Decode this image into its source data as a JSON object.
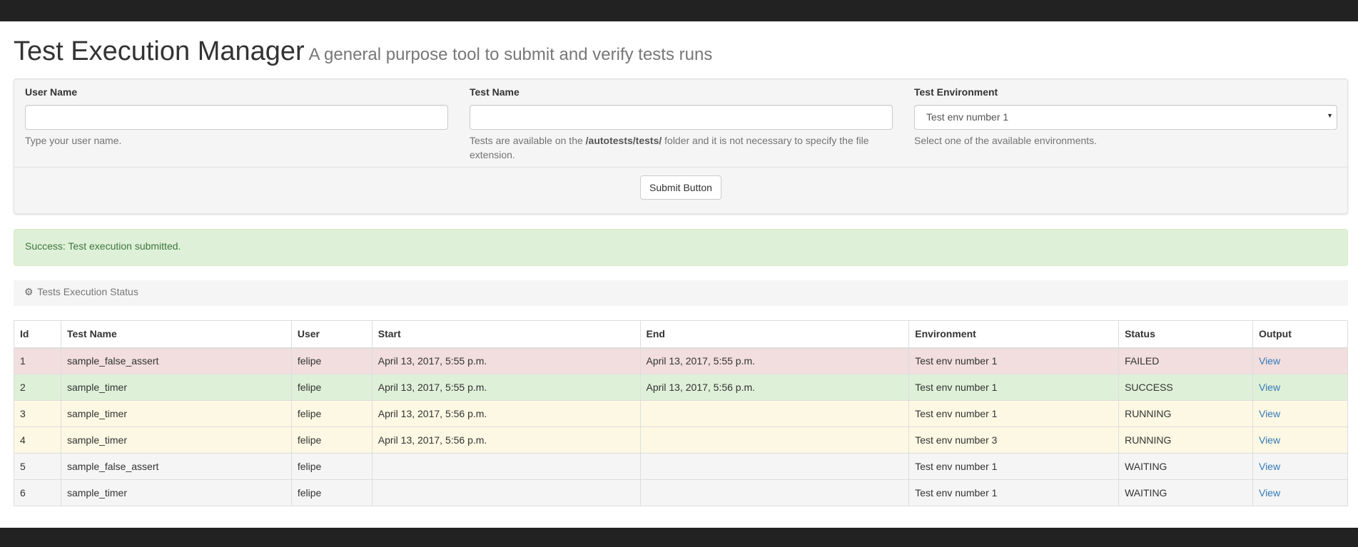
{
  "header": {
    "title": "Test Execution Manager",
    "subtitle": "A general purpose tool to submit and verify tests runs"
  },
  "form": {
    "user_name": {
      "label": "User Name",
      "value": "",
      "help": "Type your user name."
    },
    "test_name": {
      "label": "Test Name",
      "value": "",
      "help_before": "Tests are available on the ",
      "help_path": "/autotests/tests/",
      "help_after": " folder and it is not necessary to specify the file extension."
    },
    "test_environment": {
      "label": "Test Environment",
      "selected": "Test env number 1",
      "help": "Select one of the available environments."
    },
    "submit_label": "Submit Button"
  },
  "alert": {
    "text": "Success: Test execution submitted."
  },
  "status_panel": {
    "icon": "dashboard-icon",
    "title": "Tests Execution Status"
  },
  "table": {
    "columns": [
      "Id",
      "Test Name",
      "User",
      "Start",
      "End",
      "Environment",
      "Status",
      "Output"
    ],
    "rows": [
      {
        "id": "1",
        "test_name": "sample_false_assert",
        "user": "felipe",
        "start": "April 13, 2017, 5:55 p.m.",
        "end": "April 13, 2017, 5:55 p.m.",
        "environment": "Test env number 1",
        "status": "FAILED",
        "output": "View"
      },
      {
        "id": "2",
        "test_name": "sample_timer",
        "user": "felipe",
        "start": "April 13, 2017, 5:55 p.m.",
        "end": "April 13, 2017, 5:56 p.m.",
        "environment": "Test env number 1",
        "status": "SUCCESS",
        "output": "View"
      },
      {
        "id": "3",
        "test_name": "sample_timer",
        "user": "felipe",
        "start": "April 13, 2017, 5:56 p.m.",
        "end": "",
        "environment": "Test env number 1",
        "status": "RUNNING",
        "output": "View"
      },
      {
        "id": "4",
        "test_name": "sample_timer",
        "user": "felipe",
        "start": "April 13, 2017, 5:56 p.m.",
        "end": "",
        "environment": "Test env number 3",
        "status": "RUNNING",
        "output": "View"
      },
      {
        "id": "5",
        "test_name": "sample_false_assert",
        "user": "felipe",
        "start": "",
        "end": "",
        "environment": "Test env number 1",
        "status": "WAITING",
        "output": "View"
      },
      {
        "id": "6",
        "test_name": "sample_timer",
        "user": "felipe",
        "start": "",
        "end": "",
        "environment": "Test env number 1",
        "status": "WAITING",
        "output": "View"
      }
    ]
  },
  "colors": {
    "navbar": "#222222",
    "failed_row": "#f2dede",
    "success_row": "#dff0d8",
    "running_row": "#fcf8e3",
    "waiting_row": "#f5f5f5",
    "link": "#337ab7",
    "alert_text": "#3c763d"
  }
}
